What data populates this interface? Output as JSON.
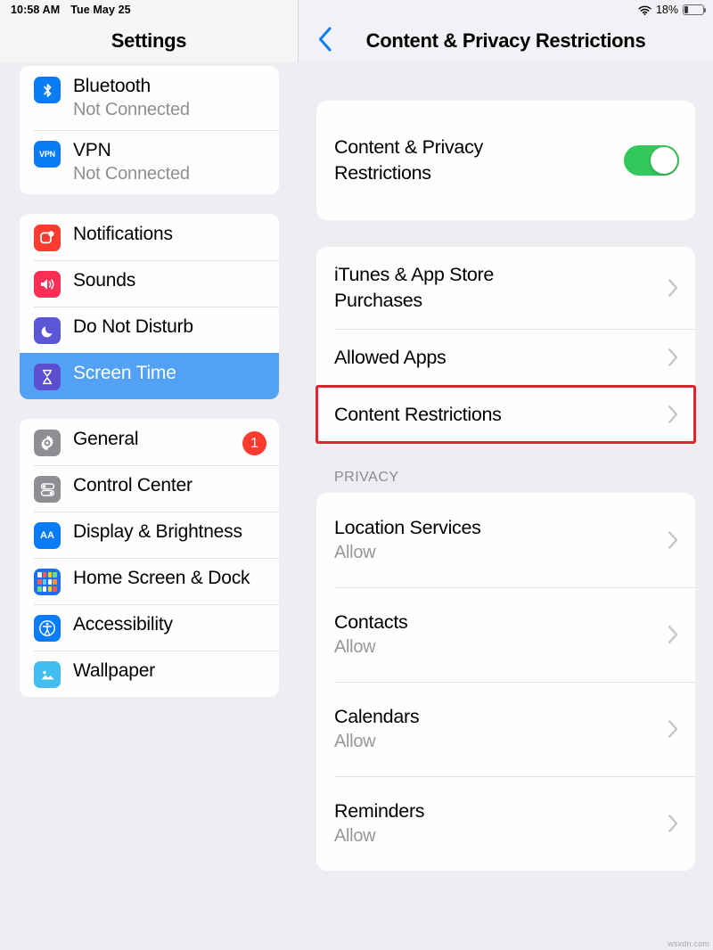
{
  "status_bar": {
    "time": "10:58 AM",
    "date": "Tue May 25",
    "battery_percent": "18%",
    "wifi_icon": "wifi-icon",
    "battery_icon": "battery-icon",
    "battery_level": 18
  },
  "sidebar": {
    "title": "Settings",
    "groups": [
      {
        "items": [
          {
            "label": "Bluetooth",
            "sub": "Not Connected",
            "icon": "bluetooth-icon",
            "icon_color": "#0A7CF6",
            "selected": false
          },
          {
            "label": "VPN",
            "sub": "Not Connected",
            "icon": "vpn-icon",
            "icon_color": "#0A7CF6",
            "icon_text": "VPN",
            "selected": false
          }
        ]
      },
      {
        "items": [
          {
            "label": "Notifications",
            "sub": "",
            "icon": "notifications-icon",
            "icon_color": "#FB3B30",
            "selected": false
          },
          {
            "label": "Sounds",
            "sub": "",
            "icon": "sounds-icon",
            "icon_color": "#FA2F55",
            "selected": false
          },
          {
            "label": "Do Not Disturb",
            "sub": "",
            "icon": "moon-icon",
            "icon_color": "#5A56D6",
            "selected": false
          },
          {
            "label": "Screen Time",
            "sub": "",
            "icon": "hourglass-icon",
            "icon_color": "#5B4FD0",
            "selected": true
          }
        ]
      },
      {
        "items": [
          {
            "label": "General",
            "sub": "",
            "icon": "gear-icon",
            "icon_color": "#8E8E93",
            "badge": "1",
            "selected": false
          },
          {
            "label": "Control Center",
            "sub": "",
            "icon": "control-center-icon",
            "icon_color": "#8E8E93",
            "selected": false
          },
          {
            "label": "Display & Brightness",
            "sub": "",
            "icon": "display-icon",
            "icon_color": "#0A7CF6",
            "icon_text": "AA",
            "selected": false
          },
          {
            "label": "Home Screen & Dock",
            "sub": "",
            "icon": "home-screen-icon",
            "icon_color": "#1B6FF0",
            "selected": false
          },
          {
            "label": "Accessibility",
            "sub": "",
            "icon": "accessibility-icon",
            "icon_color": "#0A7CF6",
            "selected": false
          },
          {
            "label": "Wallpaper",
            "sub": "",
            "icon": "wallpaper-icon",
            "icon_color": "#41BDF0",
            "selected": false
          }
        ]
      }
    ],
    "selected_accent": "#52A1F5",
    "badge_color": "#FF3B30"
  },
  "detail": {
    "back_icon": "chevron-left-icon",
    "title": "Content & Privacy Restrictions",
    "toggle_row": {
      "label": "Content & Privacy Restrictions",
      "toggle_state": "on",
      "toggle_color": "#34C759"
    },
    "restrictions_rows": [
      {
        "label": "iTunes & App Store Purchases",
        "sub": "",
        "highlighted": false
      },
      {
        "label": "Allowed Apps",
        "sub": "",
        "highlighted": false
      },
      {
        "label": "Content Restrictions",
        "sub": "",
        "highlighted": true
      }
    ],
    "privacy_header": "PRIVACY",
    "privacy_rows": [
      {
        "label": "Location Services",
        "sub": "Allow"
      },
      {
        "label": "Contacts",
        "sub": "Allow"
      },
      {
        "label": "Calendars",
        "sub": "Allow"
      },
      {
        "label": "Reminders",
        "sub": "Allow"
      }
    ],
    "highlight_color": "#E02532"
  },
  "watermark": "wsxdn.com"
}
